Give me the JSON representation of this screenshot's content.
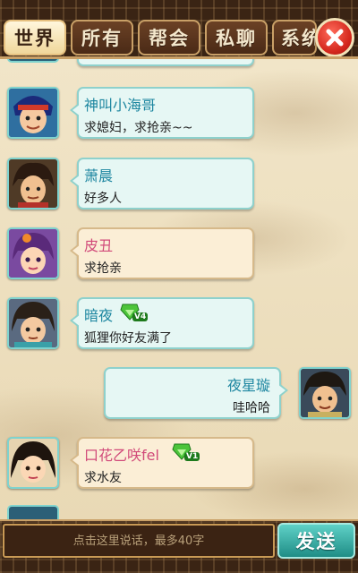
{
  "tabs": [
    {
      "label": "世界",
      "active": true
    },
    {
      "label": "所有",
      "active": false
    },
    {
      "label": "帮会",
      "active": false
    },
    {
      "label": "私聊",
      "active": false
    },
    {
      "label": "系统",
      "active": false
    }
  ],
  "close_icon": "close-icon",
  "messages": [
    {
      "name": "神叫小海哥",
      "text": "求媳妇，求抢亲~~",
      "side": "left",
      "style": "cyan",
      "name_color": "#1d86a0",
      "badge": null
    },
    {
      "name": "萧晨",
      "text": "好多人",
      "side": "left",
      "style": "cyan",
      "name_color": "#1d86a0",
      "badge": null
    },
    {
      "name": "皮丑",
      "text": "求抢亲",
      "side": "left",
      "style": "beige",
      "name_color": "#d14a7a",
      "badge": null
    },
    {
      "name": "暗夜",
      "text": "狐狸你好友满了",
      "side": "left",
      "style": "cyan",
      "name_color": "#1d86a0",
      "badge": "V4"
    },
    {
      "name": "夜星璇",
      "text": "哇哈哈",
      "side": "right",
      "style": "cyan",
      "name_color": "#1d86a0",
      "badge": null
    },
    {
      "name": "口花乙咲fel",
      "text": "求水友",
      "side": "left",
      "style": "beige",
      "name_color": "#d14a7a",
      "badge": "V1"
    }
  ],
  "input": {
    "placeholder": "点击这里说话，最多40字"
  },
  "send_label": "发送",
  "colors": {
    "accent": "#c9a067",
    "frame": "#3a2414",
    "send": "#2aa79e",
    "close": "#d3261c"
  }
}
